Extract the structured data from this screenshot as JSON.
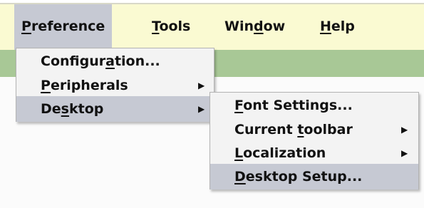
{
  "menubar": {
    "items": [
      {
        "pre": "",
        "u": "P",
        "post": "reference"
      },
      {
        "pre": "",
        "u": "T",
        "post": "ools"
      },
      {
        "pre": "Win",
        "u": "d",
        "post": "ow"
      },
      {
        "pre": "",
        "u": "H",
        "post": "elp"
      }
    ]
  },
  "preference_menu": {
    "items": [
      {
        "pre": "Configur",
        "u": "a",
        "post": "tion...",
        "submenu": false
      },
      {
        "pre": "",
        "u": "P",
        "post": "eripherals",
        "submenu": true
      },
      {
        "pre": "De",
        "u": "s",
        "post": "ktop",
        "submenu": true
      }
    ]
  },
  "desktop_menu": {
    "items": [
      {
        "pre": "",
        "u": "F",
        "post": "ont Settings...",
        "submenu": false
      },
      {
        "pre": "Current ",
        "u": "t",
        "post": "oolbar",
        "submenu": true
      },
      {
        "pre": "",
        "u": "L",
        "post": "ocalization",
        "submenu": true
      },
      {
        "pre": "",
        "u": "D",
        "post": "esktop Setup...",
        "submenu": false
      }
    ]
  },
  "icons": {
    "submenu_arrow": "▶"
  },
  "colors": {
    "menubar_bg": "#fafad2",
    "highlight": "#c6c9d3",
    "toolbar_green": "#a8c896",
    "menu_bg": "#f3f3f3"
  }
}
